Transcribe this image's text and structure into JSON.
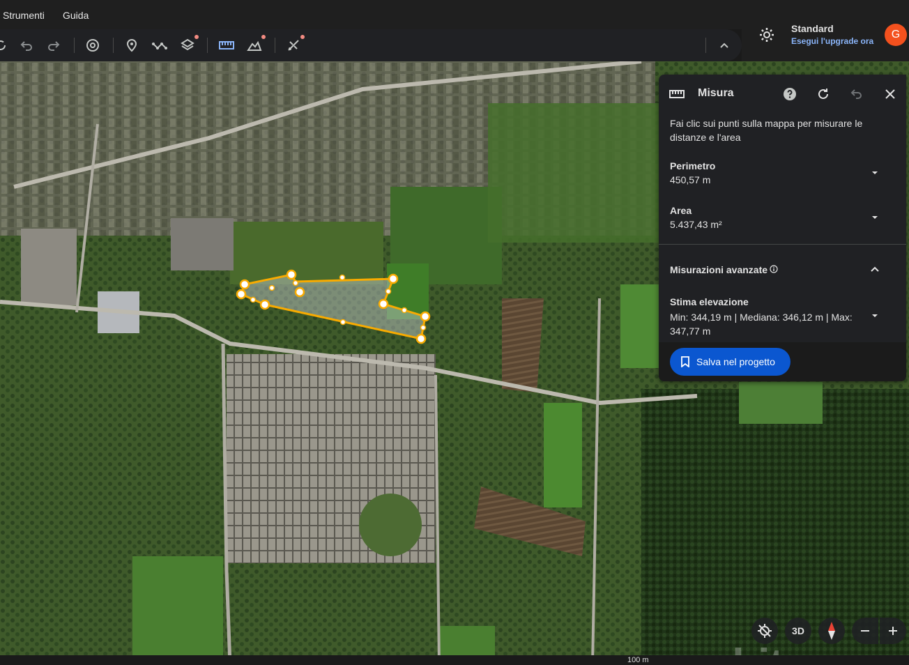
{
  "menu": {
    "items": [
      "Strumenti",
      "Guida"
    ]
  },
  "account": {
    "plan": "Standard",
    "upgrade": "Esegui l'upgrade ora",
    "avatar_letter": "G",
    "avatar_color": "#f4511e"
  },
  "panel": {
    "title": "Misura",
    "description": "Fai clic sui punti sulla mappa per misurare le distanze e l'area",
    "perimeter_label": "Perimetro",
    "perimeter_value": "450,57 m",
    "area_label": "Area",
    "area_value": "5.437,43 m²",
    "advanced_label": "Misurazioni avanzate",
    "elevation_label": "Stima elevazione",
    "elevation_value": "Min: 344,19 m | Mediana: 346,12 m | Max: 347,77 m",
    "save_label": "Salva nel progetto"
  },
  "map_controls": {
    "three_d_label": "3D"
  },
  "footer": {
    "scale_label": "100 m"
  },
  "watermark": "subito",
  "colors": {
    "accent": "#0b57d0",
    "measure_line": "#f9ab00",
    "toolbar_active": "#8ab4f8"
  }
}
